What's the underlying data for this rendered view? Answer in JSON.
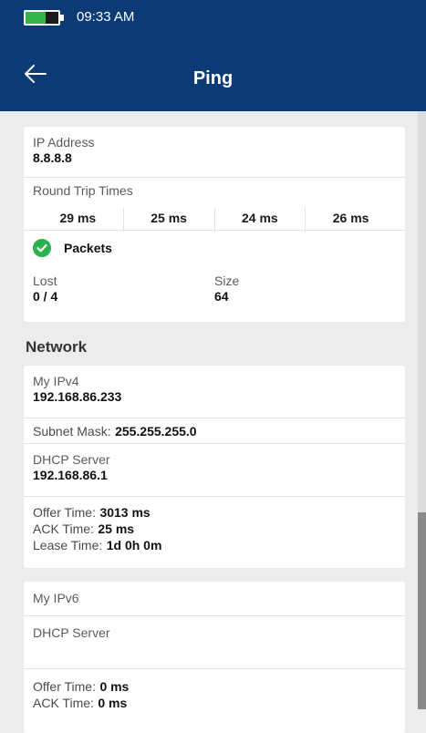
{
  "status_bar": {
    "time": "09:33 AM",
    "battery_level": 0.6,
    "battery_color": "#33b34a"
  },
  "header": {
    "title": "Ping",
    "back_icon": "arrow-left-icon",
    "bg_color": "#0b3a75"
  },
  "ping": {
    "ip_label": "IP Address",
    "ip_value": "8.8.8.8",
    "rtt_label": "Round Trip Times",
    "rtt_values": [
      "29 ms",
      "25 ms",
      "24 ms",
      "26 ms"
    ],
    "packets_label": "Packets",
    "packets_icon": "check-circle-icon",
    "packets_icon_color": "#2bb24c",
    "lost_label": "Lost",
    "lost_value": "0 / 4",
    "size_label": "Size",
    "size_value": "64"
  },
  "network": {
    "title": "Network",
    "ipv4": {
      "label": "My IPv4",
      "value": "192.168.86.233",
      "subnet_label": "Subnet Mask:",
      "subnet_value": "255.255.255.0",
      "dhcp_label": "DHCP Server",
      "dhcp_value": "192.168.86.1",
      "offer_label": "Offer Time:",
      "offer_value": "3013 ms",
      "ack_label": "ACK Time:",
      "ack_value": "25 ms",
      "lease_label": "Lease Time:",
      "lease_value": "1d 0h 0m"
    },
    "ipv6": {
      "label": "My IPv6",
      "dhcp_label": "DHCP Server",
      "offer_label": "Offer Time:",
      "offer_value": "0 ms",
      "ack_label": "ACK Time:",
      "ack_value": "0 ms"
    }
  },
  "scrollbar": {
    "position": 0.67,
    "thumb_fraction": 0.33
  }
}
